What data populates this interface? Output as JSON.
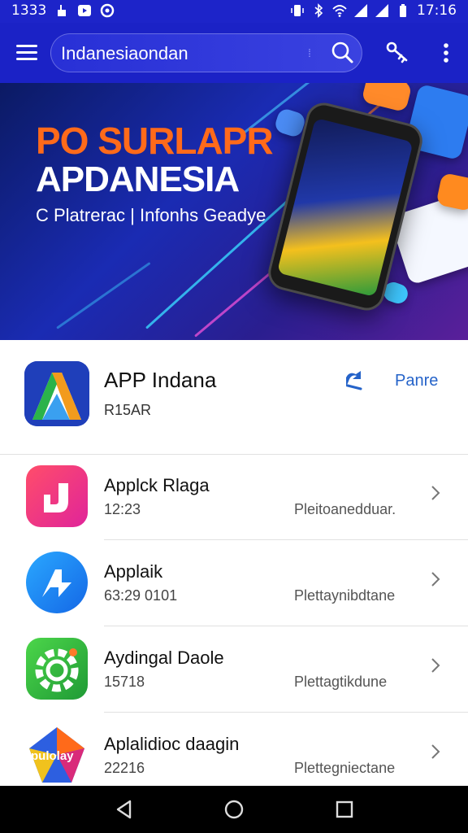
{
  "status_bar": {
    "time_left": "1333",
    "time_right": "17:16"
  },
  "app_bar": {
    "search": {
      "value": "Indanesiaondan",
      "placeholder": "Indanesiaondan"
    }
  },
  "hero": {
    "title_line1": "PO SURLAPR",
    "title_line2": "APDANESIA",
    "subtitle": "C Platrerac | Infonhs Geadye"
  },
  "featured": {
    "name": "APP Indana",
    "subtitle": "R15AR",
    "action": "Panre"
  },
  "list": [
    {
      "name": "Applck Rlaga",
      "meta": "12:23",
      "category": "Pleitoanedduar.",
      "icon": "j-app-icon"
    },
    {
      "name": "Applaik",
      "meta": "63:29 0101",
      "category": "Plettaynibdtane",
      "icon": "arrow-app-icon"
    },
    {
      "name": "Aydingal Daole",
      "meta": "15718",
      "category": "Plettagtikdune",
      "icon": "gear-app-icon"
    },
    {
      "name": "Aplalidioc daagin",
      "meta": "22216",
      "category": "Plettegniectane",
      "icon": "pulplay-app-icon"
    }
  ],
  "colors": {
    "app_bar": "#1b22c6",
    "accent": "#2563c9"
  }
}
